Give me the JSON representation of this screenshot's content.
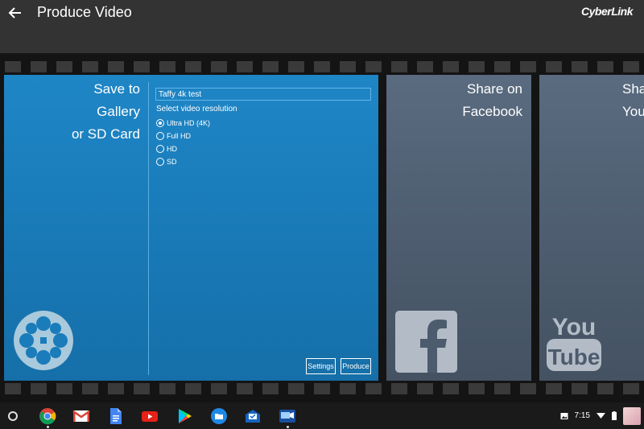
{
  "app": {
    "title": "Produce Video",
    "brand": "CyberLink"
  },
  "save_card": {
    "title_lines": [
      "Save to",
      "Gallery",
      "or SD Card"
    ],
    "filename_value": "Taffy 4k test",
    "resolution_label": "Select video resolution",
    "options": [
      {
        "label": "Ultra HD (4K)",
        "selected": true
      },
      {
        "label": "Full HD",
        "selected": false
      },
      {
        "label": "HD",
        "selected": false
      },
      {
        "label": "SD",
        "selected": false
      }
    ],
    "settings_label": "Settings",
    "produce_label": "Produce",
    "icon": "film-reel-icon"
  },
  "facebook_card": {
    "title_lines": [
      "Share on",
      "Facebook"
    ],
    "icon": "facebook-icon"
  },
  "youtube_card": {
    "title_lines": [
      "Sha",
      "You"
    ],
    "icon_text": [
      "You",
      "Tube"
    ]
  },
  "shelf": {
    "apps": [
      "chrome-icon",
      "gmail-icon",
      "docs-icon",
      "youtube-app-icon",
      "play-store-icon",
      "files-icon",
      "inbox-icon",
      "powerdirector-icon"
    ],
    "time": "7:15"
  },
  "colors": {
    "accent_blue": "#1f86c6",
    "card_gray": "#4c5b6d",
    "topbar": "#333333"
  }
}
